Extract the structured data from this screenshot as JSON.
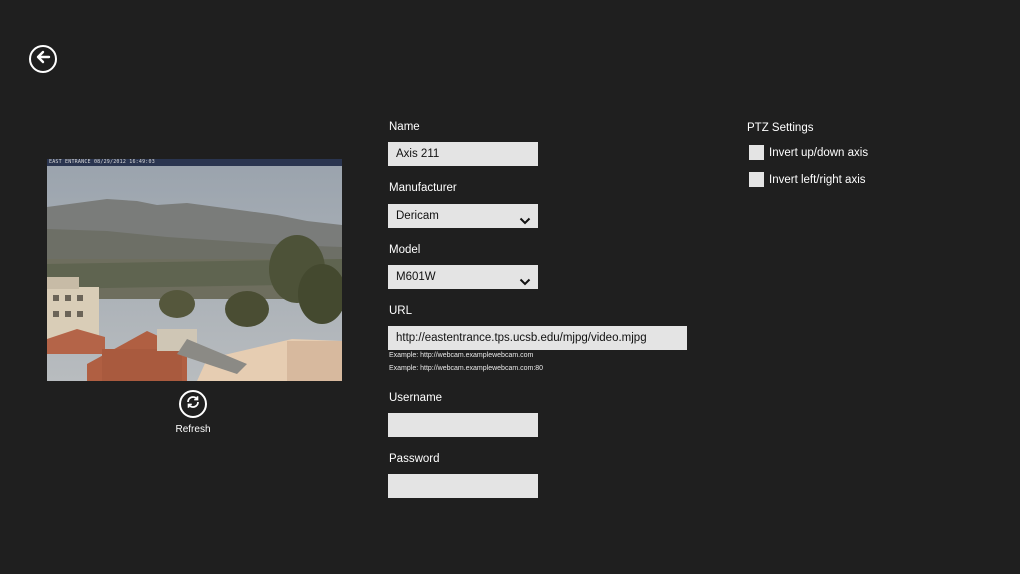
{
  "nav": {
    "back_icon": "back-arrow-icon"
  },
  "preview": {
    "overlay_text": "EAST ENTRANCE 08/29/2012 16:49:03",
    "refresh_label": "Refresh",
    "refresh_icon": "refresh-icon"
  },
  "form": {
    "name_label": "Name",
    "name_value": "Axis 211",
    "manufacturer_label": "Manufacturer",
    "manufacturer_value": "Dericam",
    "model_label": "Model",
    "model_value": "M601W",
    "url_label": "URL",
    "url_value": "http://eastentrance.tps.ucsb.edu/mjpg/video.mjpg",
    "url_example_1": "Example: http://webcam.examplewebcam.com",
    "url_example_2": "Example: http://webcam.examplewebcam.com:80",
    "username_label": "Username",
    "username_value": "",
    "password_label": "Password",
    "password_value": ""
  },
  "ptz": {
    "title": "PTZ Settings",
    "invert_updown_label": "Invert up/down axis",
    "invert_updown_checked": false,
    "invert_leftright_label": "Invert left/right axis",
    "invert_leftright_checked": false
  },
  "colors": {
    "background": "#1f1f1f",
    "field": "#e4e4e4",
    "text": "#ffffff"
  }
}
